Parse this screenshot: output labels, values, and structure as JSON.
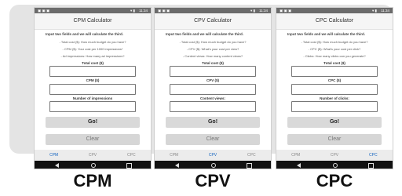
{
  "screens": [
    {
      "status": {
        "left": "▣ ▣ ▣",
        "icons": "▾ ▮",
        "time": "11:34"
      },
      "title": "CPM Calculator",
      "intro": "Input two fields and we will calculate the third.",
      "hints": [
        "- Total cost ($): How much budget do you have?",
        "- CPM ($): Your cost per 1000 impressions*",
        "- Ad impressions: How many ad impressions?"
      ],
      "fields": [
        "Total cost ($)",
        "CPM ($)",
        "Number of impressions"
      ],
      "go_label": "Go!",
      "clear_label": "Clear",
      "tabs": [
        "CPM",
        "CPV",
        "CPC"
      ],
      "active_tab": 0,
      "caption": "CPM"
    },
    {
      "status": {
        "left": "▣ ▣ ▣",
        "icons": "▾ ▮",
        "time": "11:34"
      },
      "title": "CPV Calculator",
      "intro": "Input two fields and we will calculate the third.",
      "hints": [
        "- Total cost ($): How much budget do you have?",
        "- CPV ($): What's your cost per view?",
        "- Content views: How many content views?"
      ],
      "fields": [
        "Total cost ($)",
        "CPV ($)",
        "Content views:"
      ],
      "go_label": "Go!",
      "clear_label": "Clear",
      "tabs": [
        "CPM",
        "CPV",
        "CPC"
      ],
      "active_tab": 1,
      "caption": "CPV"
    },
    {
      "status": {
        "left": "▣ ▣ ▣",
        "icons": "▾ ▮",
        "time": "11:34"
      },
      "title": "CPC Calculator",
      "intro": "Input two fields and we will calculate the third.",
      "hints": [
        "- Total cost ($): How much budget do you have?",
        "- CPC ($): What's your cost per click?",
        "- Clicks: How many clicks can you generate?"
      ],
      "fields": [
        "Total cost ($)",
        "CPC ($)",
        "Number of clicks:"
      ],
      "go_label": "Go!",
      "clear_label": "Clear",
      "tabs": [
        "CPM",
        "CPV",
        "CPC"
      ],
      "active_tab": 2,
      "caption": "CPC"
    }
  ],
  "colors": {
    "active_tab": "#1565c0",
    "statusbar": "#6b6b6b",
    "navbar": "#111111"
  }
}
